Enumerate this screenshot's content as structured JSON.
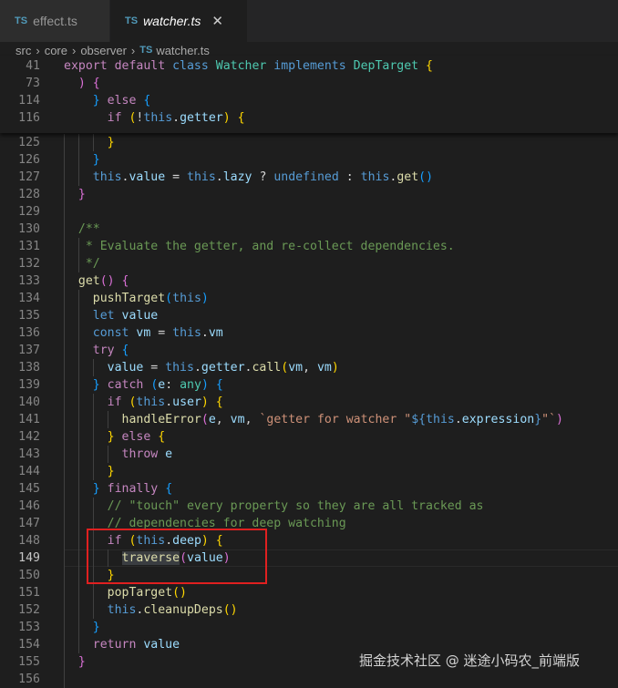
{
  "tabs": [
    {
      "badge": "TS",
      "label": "effect.ts"
    },
    {
      "badge": "TS",
      "label": "watcher.ts",
      "close": "✕"
    }
  ],
  "breadcrumb": [
    "src",
    "core",
    "observer",
    "watcher.ts"
  ],
  "breadcrumb_separator": "›",
  "colors": {
    "keyword": "#569cd6",
    "control": "#c586c0",
    "function": "#dcdcaa",
    "type": "#4ec9b0",
    "variable": "#9cdcfe",
    "text": "#d4d4d4",
    "comment": "#6a9955",
    "string": "#ce9178",
    "brace1": "#ffd700",
    "brace2": "#da70d6",
    "brace3": "#179fff",
    "red_box": "#e02020"
  },
  "sticky_lines": [
    {
      "n": "41",
      "tokens": [
        [
          "export ",
          "control"
        ],
        [
          "default ",
          "control"
        ],
        [
          "class ",
          "keyword"
        ],
        [
          "Watcher ",
          "type"
        ],
        [
          "implements ",
          "keyword"
        ],
        [
          "DepTarget ",
          "type"
        ],
        [
          "{",
          "brace1"
        ]
      ]
    },
    {
      "n": "73",
      "tokens": [
        [
          "  ",
          "text"
        ],
        [
          ") {",
          "brace2"
        ]
      ]
    },
    {
      "n": "114",
      "tokens": [
        [
          "    ",
          "text"
        ],
        [
          "}",
          "brace3"
        ],
        [
          " ",
          "text"
        ],
        [
          "else ",
          "control"
        ],
        [
          "{",
          "brace3"
        ]
      ]
    },
    {
      "n": "116",
      "tokens": [
        [
          "      ",
          "text"
        ],
        [
          "if ",
          "control"
        ],
        [
          "(",
          "brace1"
        ],
        [
          "!",
          "text"
        ],
        [
          "this",
          "keyword"
        ],
        [
          ".",
          "text"
        ],
        [
          "getter",
          "variable"
        ],
        [
          ") ",
          "brace1"
        ],
        [
          "{",
          "brace1"
        ]
      ]
    }
  ],
  "lines": [
    {
      "n": "125",
      "tokens": [
        [
          "      ",
          "text"
        ],
        [
          "}",
          "brace1"
        ]
      ]
    },
    {
      "n": "126",
      "tokens": [
        [
          "    ",
          "text"
        ],
        [
          "}",
          "brace3"
        ]
      ]
    },
    {
      "n": "127",
      "tokens": [
        [
          "    ",
          "text"
        ],
        [
          "this",
          "keyword"
        ],
        [
          ".",
          "text"
        ],
        [
          "value",
          "variable"
        ],
        [
          " = ",
          "text"
        ],
        [
          "this",
          "keyword"
        ],
        [
          ".",
          "text"
        ],
        [
          "lazy",
          "variable"
        ],
        [
          " ? ",
          "text"
        ],
        [
          "undefined",
          "keyword"
        ],
        [
          " : ",
          "text"
        ],
        [
          "this",
          "keyword"
        ],
        [
          ".",
          "text"
        ],
        [
          "get",
          "function"
        ],
        [
          "()",
          "brace3"
        ]
      ]
    },
    {
      "n": "128",
      "tokens": [
        [
          "  ",
          "text"
        ],
        [
          "}",
          "brace2"
        ]
      ]
    },
    {
      "n": "129",
      "tokens": []
    },
    {
      "n": "130",
      "tokens": [
        [
          "  /**",
          "comment"
        ]
      ]
    },
    {
      "n": "131",
      "tokens": [
        [
          "   * Evaluate the getter, and re-collect dependencies.",
          "comment"
        ]
      ]
    },
    {
      "n": "132",
      "tokens": [
        [
          "   */",
          "comment"
        ]
      ]
    },
    {
      "n": "133",
      "tokens": [
        [
          "  ",
          "text"
        ],
        [
          "get",
          "function"
        ],
        [
          "() ",
          "brace2"
        ],
        [
          "{",
          "brace2"
        ]
      ]
    },
    {
      "n": "134",
      "tokens": [
        [
          "    ",
          "text"
        ],
        [
          "pushTarget",
          "function"
        ],
        [
          "(",
          "brace3"
        ],
        [
          "this",
          "keyword"
        ],
        [
          ")",
          "brace3"
        ]
      ]
    },
    {
      "n": "135",
      "tokens": [
        [
          "    ",
          "text"
        ],
        [
          "let ",
          "keyword"
        ],
        [
          "value",
          "variable"
        ]
      ]
    },
    {
      "n": "136",
      "tokens": [
        [
          "    ",
          "text"
        ],
        [
          "const ",
          "keyword"
        ],
        [
          "vm",
          "variable"
        ],
        [
          " = ",
          "text"
        ],
        [
          "this",
          "keyword"
        ],
        [
          ".",
          "text"
        ],
        [
          "vm",
          "variable"
        ]
      ]
    },
    {
      "n": "137",
      "tokens": [
        [
          "    ",
          "text"
        ],
        [
          "try ",
          "control"
        ],
        [
          "{",
          "brace3"
        ]
      ]
    },
    {
      "n": "138",
      "tokens": [
        [
          "      ",
          "text"
        ],
        [
          "value",
          "variable"
        ],
        [
          " = ",
          "text"
        ],
        [
          "this",
          "keyword"
        ],
        [
          ".",
          "text"
        ],
        [
          "getter",
          "variable"
        ],
        [
          ".",
          "text"
        ],
        [
          "call",
          "function"
        ],
        [
          "(",
          "brace1"
        ],
        [
          "vm",
          "variable"
        ],
        [
          ", ",
          "text"
        ],
        [
          "vm",
          "variable"
        ],
        [
          ")",
          "brace1"
        ]
      ]
    },
    {
      "n": "139",
      "tokens": [
        [
          "    ",
          "text"
        ],
        [
          "}",
          "brace3"
        ],
        [
          " ",
          "text"
        ],
        [
          "catch ",
          "control"
        ],
        [
          "(",
          "brace3"
        ],
        [
          "e",
          "variable"
        ],
        [
          ": ",
          "text"
        ],
        [
          "any",
          "type"
        ],
        [
          ") ",
          "brace3"
        ],
        [
          "{",
          "brace3"
        ]
      ]
    },
    {
      "n": "140",
      "tokens": [
        [
          "      ",
          "text"
        ],
        [
          "if ",
          "control"
        ],
        [
          "(",
          "brace1"
        ],
        [
          "this",
          "keyword"
        ],
        [
          ".",
          "text"
        ],
        [
          "user",
          "variable"
        ],
        [
          ") ",
          "brace1"
        ],
        [
          "{",
          "brace1"
        ]
      ]
    },
    {
      "n": "141",
      "tokens": [
        [
          "        ",
          "text"
        ],
        [
          "handleError",
          "function"
        ],
        [
          "(",
          "brace2"
        ],
        [
          "e",
          "variable"
        ],
        [
          ", ",
          "text"
        ],
        [
          "vm",
          "variable"
        ],
        [
          ", ",
          "text"
        ],
        [
          "`getter for watcher \"",
          "string"
        ],
        [
          "${",
          "keyword"
        ],
        [
          "this",
          "keyword"
        ],
        [
          ".",
          "text"
        ],
        [
          "expression",
          "variable"
        ],
        [
          "}",
          "keyword"
        ],
        [
          "\"`",
          "string"
        ],
        [
          ")",
          "brace2"
        ]
      ]
    },
    {
      "n": "142",
      "tokens": [
        [
          "      ",
          "text"
        ],
        [
          "}",
          "brace1"
        ],
        [
          " ",
          "text"
        ],
        [
          "else ",
          "control"
        ],
        [
          "{",
          "brace1"
        ]
      ]
    },
    {
      "n": "143",
      "tokens": [
        [
          "        ",
          "text"
        ],
        [
          "throw ",
          "control"
        ],
        [
          "e",
          "variable"
        ]
      ]
    },
    {
      "n": "144",
      "tokens": [
        [
          "      ",
          "text"
        ],
        [
          "}",
          "brace1"
        ]
      ]
    },
    {
      "n": "145",
      "tokens": [
        [
          "    ",
          "text"
        ],
        [
          "}",
          "brace3"
        ],
        [
          " ",
          "text"
        ],
        [
          "finally ",
          "control"
        ],
        [
          "{",
          "brace3"
        ]
      ]
    },
    {
      "n": "146",
      "tokens": [
        [
          "      // \"touch\" every property so they are all tracked as",
          "comment"
        ]
      ]
    },
    {
      "n": "147",
      "tokens": [
        [
          "      // dependencies for deep watching",
          "comment"
        ]
      ]
    },
    {
      "n": "148",
      "tokens": [
        [
          "      ",
          "text"
        ],
        [
          "if ",
          "control"
        ],
        [
          "(",
          "brace1"
        ],
        [
          "this",
          "keyword"
        ],
        [
          ".",
          "text"
        ],
        [
          "deep",
          "variable"
        ],
        [
          ") ",
          "brace1"
        ],
        [
          "{",
          "brace1"
        ]
      ]
    },
    {
      "n": "149",
      "tokens": [
        [
          "        ",
          "text"
        ],
        [
          "traverse",
          "function",
          "hl"
        ],
        [
          "(",
          "brace2"
        ],
        [
          "value",
          "variable"
        ],
        [
          ")",
          "brace2"
        ]
      ]
    },
    {
      "n": "150",
      "tokens": [
        [
          "      ",
          "text"
        ],
        [
          "}",
          "brace1"
        ]
      ]
    },
    {
      "n": "151",
      "tokens": [
        [
          "      ",
          "text"
        ],
        [
          "popTarget",
          "function"
        ],
        [
          "()",
          "brace1"
        ]
      ]
    },
    {
      "n": "152",
      "tokens": [
        [
          "      ",
          "text"
        ],
        [
          "this",
          "keyword"
        ],
        [
          ".",
          "text"
        ],
        [
          "cleanupDeps",
          "function"
        ],
        [
          "()",
          "brace1"
        ]
      ]
    },
    {
      "n": "153",
      "tokens": [
        [
          "    ",
          "text"
        ],
        [
          "}",
          "brace3"
        ]
      ]
    },
    {
      "n": "154",
      "tokens": [
        [
          "    ",
          "text"
        ],
        [
          "return ",
          "control"
        ],
        [
          "value",
          "variable"
        ]
      ]
    },
    {
      "n": "155",
      "tokens": [
        [
          "  ",
          "text"
        ],
        [
          "}",
          "brace2"
        ]
      ]
    },
    {
      "n": "156",
      "tokens": []
    }
  ],
  "active_line": "149",
  "watermark": "掘金技术社区 @ 迷途小码农_前端版"
}
